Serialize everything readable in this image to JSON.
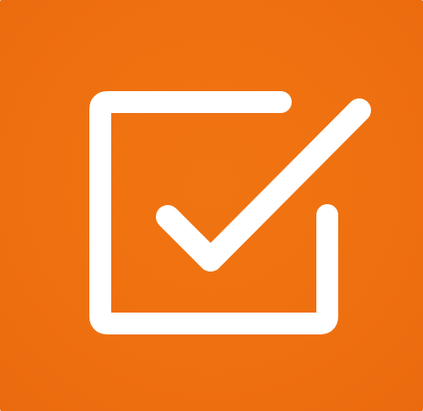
{
  "app_icon": {
    "name": "task-checklist",
    "icon": "checkbox-check-icon",
    "accent_color": "#EF7010",
    "glyph_color": "#FFFFFF"
  }
}
